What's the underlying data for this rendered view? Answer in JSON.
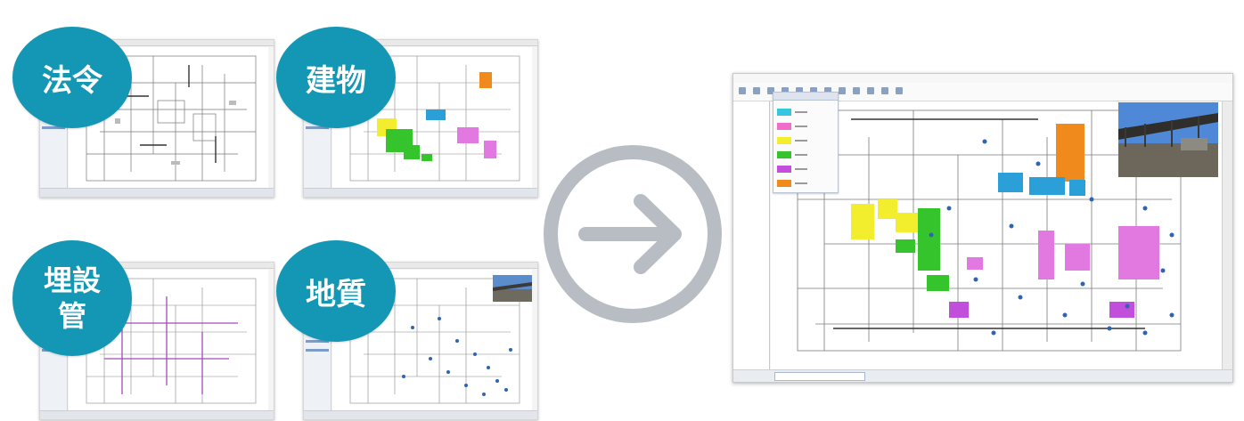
{
  "badges": {
    "hourei": "法令",
    "tatemono": "建物",
    "maisetsukan_line1": "埋設",
    "maisetsukan_line2": "管",
    "chishitsu": "地質"
  },
  "colors": {
    "badge": "#1497b4",
    "arrow": "#b8bdc4",
    "building_yellow": "#f2ee2e",
    "building_green": "#35c42c",
    "building_magenta": "#e279e0",
    "building_orange": "#f08a1c",
    "building_blue": "#2a9fd8",
    "pipe_purple": "#a04bb4",
    "survey_point_blue": "#2f64b3"
  },
  "icons": {
    "arrow": "circled-right-arrow-icon"
  },
  "legend_swatches": [
    "#35c6e0",
    "#f06ec8",
    "#f2ee2e",
    "#35c42c",
    "#c24fdb",
    "#f08a1c"
  ]
}
